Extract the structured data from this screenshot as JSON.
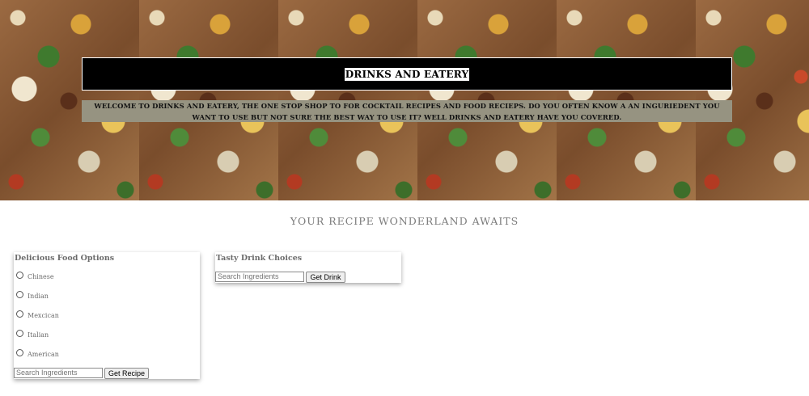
{
  "header": {
    "title": "DRINKS AND EATERY",
    "welcome": "WELCOME TO DRINKS AND EATERY, THE ONE STOP SHOP TO FOR COCKTAIL RECIPES AND FOOD RECIEPS. DO YOU OFTEN KNOW A AN INGURIEDENT YOU WANT TO USE BUT NOT SURE THE BEST WAY TO USE IT? WELL DRINKS AND EATERY HAVE YOU COVERED."
  },
  "tagline": "YOUR RECIPE WONDERLAND AWAITS",
  "food": {
    "title": "Delicious Food Options",
    "options": [
      "Chinese",
      "Indian",
      "Mexcican",
      "Italian",
      "American"
    ],
    "search_placeholder": "Search Ingredients",
    "button_label": "Get Recipe"
  },
  "drink": {
    "title": "Tasty Drink Choices",
    "search_placeholder": "Search Ingredients",
    "button_label": "Get Drink"
  }
}
